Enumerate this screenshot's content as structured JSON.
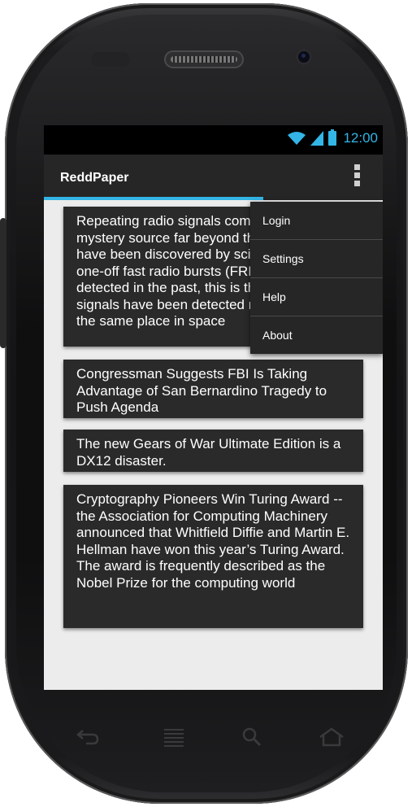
{
  "status_bar": {
    "time": "12:00",
    "accent_color": "#33b5e5"
  },
  "action_bar": {
    "title": "ReddPaper",
    "overflow_icon": "overflow-menu-icon"
  },
  "overflow_menu": {
    "items": [
      {
        "label": "Login"
      },
      {
        "label": "Settings"
      },
      {
        "label": "Help"
      },
      {
        "label": "About"
      }
    ]
  },
  "posts": [
    {
      "text": "Repeating radio signals coming from a mystery source far beyond the Milky Way have been discovered by scientists. While one-off fast radio bursts (FRBs) have been detected in the past, this is the first time the signals have been detected repeating from the same place in space"
    },
    {
      "text": "Congressman Suggests FBI Is Taking Advantage of San Bernardino Tragedy to Push Agenda"
    },
    {
      "text": "The new Gears of War Ultimate Edition is a DX12 disaster."
    },
    {
      "text": "Cryptography Pioneers Win Turing Award -- the Association for Computing Machinery announced that Whitfield Diffie and Martin E. Hellman have won this year’s Turing Award. The award is frequently described as the Nobel Prize for the computing world"
    }
  ],
  "nav_bar": {
    "icons": [
      "back-icon",
      "recent-apps-icon",
      "search-icon",
      "home-icon"
    ]
  }
}
